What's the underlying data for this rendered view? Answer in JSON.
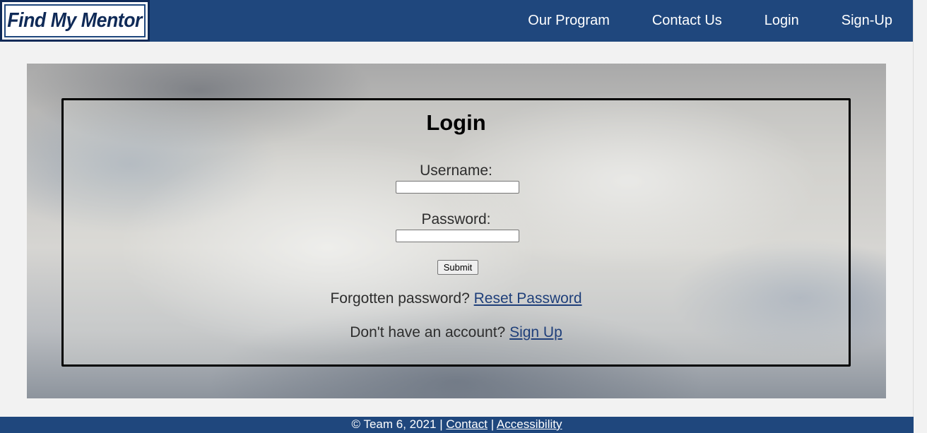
{
  "header": {
    "logo_text": "Find My Mentor",
    "nav": [
      {
        "label": "Our Program"
      },
      {
        "label": "Contact Us"
      },
      {
        "label": "Login"
      },
      {
        "label": "Sign-Up"
      }
    ]
  },
  "login": {
    "title": "Login",
    "username_label": "Username:",
    "username_value": "",
    "password_label": "Password:",
    "password_value": "",
    "submit_label": "Submit",
    "forgot_text": "Forgotten password?",
    "reset_link": "Reset Password",
    "no_account_text": "Don't have an account?",
    "signup_link": "Sign Up"
  },
  "footer": {
    "copyright": "© Team 6, 2021",
    "separator": "|",
    "contact_link": "Contact",
    "accessibility_link": "Accessibility"
  },
  "colors": {
    "brand": "#1f477d",
    "link": "#1f3f7a",
    "page_bg": "#f2f2f2"
  }
}
